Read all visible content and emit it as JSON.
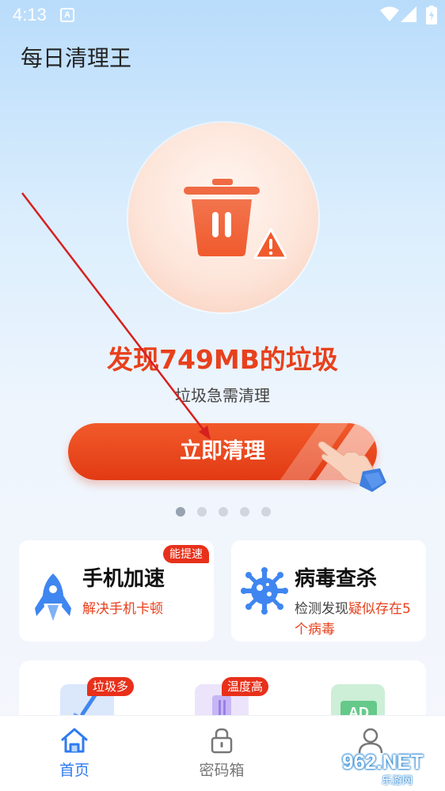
{
  "status_bar": {
    "time": "4:13",
    "notification_letter": "A"
  },
  "app": {
    "title": "每日清理王"
  },
  "hero": {
    "headline": "发现749MB的垃圾",
    "subtitle": "垃圾急需清理",
    "icon": "trash-warning-icon"
  },
  "clean_button": {
    "label": "立即清理"
  },
  "carousel": {
    "count": 5,
    "active_index": 0
  },
  "features": [
    {
      "title": "手机加速",
      "badge": "能提速",
      "desc": "解决手机卡顿",
      "icon": "rocket-icon"
    },
    {
      "title": "病毒查杀",
      "desc_prefix": "检测发现",
      "desc_highlight": "疑似存在5个病毒",
      "icon": "virus-icon"
    }
  ],
  "tools": {
    "junk_badge": "垃圾多",
    "temp_badge": "温度高",
    "ad_label": "AD"
  },
  "bottom_nav": {
    "items": [
      {
        "label": "首页",
        "icon": "home-icon",
        "active": true
      },
      {
        "label": "密码箱",
        "icon": "lock-icon",
        "active": false
      },
      {
        "label": "",
        "icon": "person-icon",
        "active": false
      }
    ]
  },
  "watermark": {
    "main": "962.NET",
    "sub": "乐游网"
  },
  "colors": {
    "accent": "#e8401c",
    "nav_active": "#2e7bf0",
    "badge": "#e8301a"
  }
}
